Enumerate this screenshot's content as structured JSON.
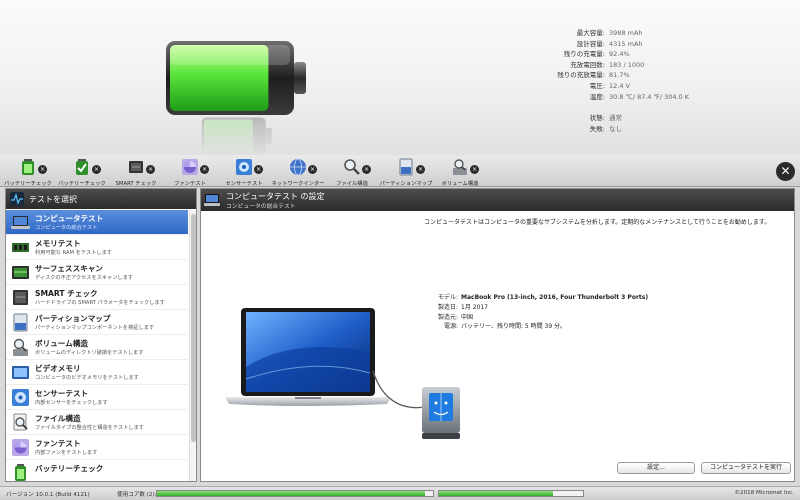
{
  "battery_stats": [
    {
      "label": "最大容量:",
      "value": "3988 mAh"
    },
    {
      "label": "設計容量:",
      "value": "4315 mAh"
    },
    {
      "label": "残りの充電量:",
      "value": "92.4%"
    },
    {
      "label": "充放電回数:",
      "value": "183 / 1000"
    },
    {
      "label": "残りの充放電量:",
      "value": "81.7%"
    },
    {
      "label": "電圧:",
      "value": "12.4 V"
    },
    {
      "label": "温度:",
      "value": "30.8 ℃/ 87.4 ℉/ 304.0 K"
    }
  ],
  "battery_status": [
    {
      "label": "状態:",
      "value": "通常"
    },
    {
      "label": "失敗:",
      "value": "なし"
    }
  ],
  "battery_level": 0.82,
  "toolbar": {
    "items": [
      {
        "label": "バッテリーチェック",
        "icon": "battery-icon"
      },
      {
        "label": "バッテリーチェック",
        "icon": "battery-check-icon"
      },
      {
        "label": "SMART チェック",
        "icon": "chip-icon"
      },
      {
        "label": "ファンテスト",
        "icon": "fan-icon"
      },
      {
        "label": "センサーテスト",
        "icon": "sensor-icon"
      },
      {
        "label": "ネットワークインター",
        "icon": "globe-icon"
      },
      {
        "label": "ファイル構造",
        "icon": "magnifier-icon"
      },
      {
        "label": "パーティションマップ",
        "icon": "partition-icon"
      },
      {
        "label": "ボリューム構造",
        "icon": "volume-icon"
      }
    ],
    "remove_glyph": "×",
    "close_glyph": "✕"
  },
  "sidebar": {
    "header": "テストを選択",
    "items": [
      {
        "title": "コンピュータテスト",
        "subtitle": "コンピュータの総合テスト",
        "icon": "computer-icon"
      },
      {
        "title": "メモリテスト",
        "subtitle": "利用可能な RAM をテストします",
        "icon": "memory-icon"
      },
      {
        "title": "サーフェススキャン",
        "subtitle": "ディスクの不正アクセスをスキャンします",
        "icon": "disk-scan-icon"
      },
      {
        "title": "SMART チェック",
        "subtitle": "ハードドライブの SMART パラメータをチェックします",
        "icon": "chip-icon"
      },
      {
        "title": "パーティションマップ",
        "subtitle": "パーティションマップコンポーネントを検証します",
        "icon": "partition-icon"
      },
      {
        "title": "ボリューム構造",
        "subtitle": "ボリュームのディレクトリ破損をテストします",
        "icon": "volume-icon"
      },
      {
        "title": "ビデオメモリ",
        "subtitle": "コンピュータのビデオメモリをテストします",
        "icon": "video-memory-icon"
      },
      {
        "title": "センサーテスト",
        "subtitle": "内部センサーをチェックします",
        "icon": "sensor-icon"
      },
      {
        "title": "ファイル構造",
        "subtitle": "ファイルタイプの整合性と構造をテストします",
        "icon": "magnifier-icon"
      },
      {
        "title": "ファンテスト",
        "subtitle": "内部ファンをテストします",
        "icon": "fan-icon"
      },
      {
        "title": "バッテリーチェック",
        "subtitle": "",
        "icon": "battery-icon"
      }
    ]
  },
  "main": {
    "title": "コンピュータテスト の設定",
    "subtitle": "コンピュータの総合テスト",
    "description": "コンピュータテストはコンピュータの重要なサブシステムを分析します。定期的なメンテナンスとして行うことをお勧めします。",
    "info": [
      {
        "label": "モデル:",
        "value": "MacBook Pro (13-inch, 2016, Four Thunderbolt 3 Ports)",
        "bold": true
      },
      {
        "label": "製造日:",
        "value": "1月 2017"
      },
      {
        "label": "製造元:",
        "value": "中国"
      },
      {
        "label": "電源:",
        "value": "バッテリー、残り時間: 5 時間 39 分。"
      }
    ],
    "settings_button": "設定...",
    "run_button": "コンピュータテストを実行"
  },
  "statusbar": {
    "version": "バージョン 10.0.1 (Build 4121)",
    "cores": "使用コア数 (2):",
    "core_load": [
      0.97,
      0.79
    ],
    "copyright": "©2018 Micromat Inc."
  }
}
